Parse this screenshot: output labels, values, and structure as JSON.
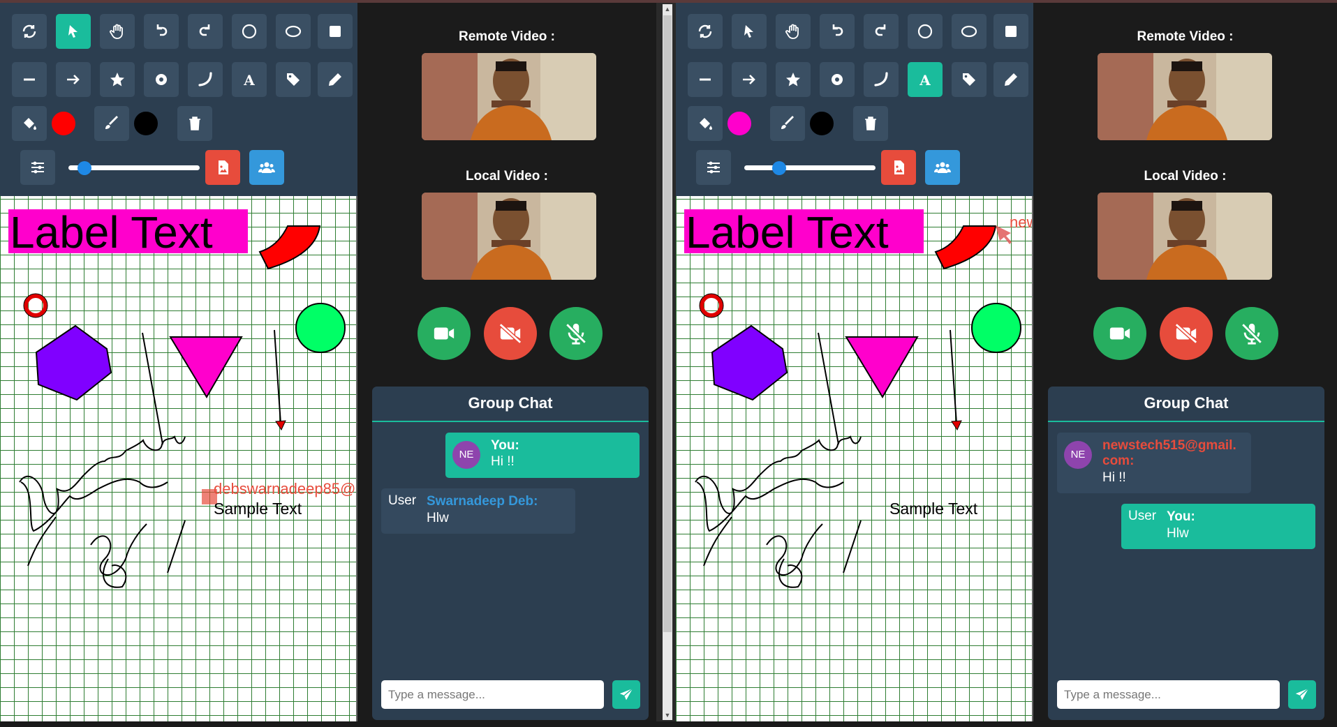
{
  "colors": {
    "toolbar_bg": "#2c3e50",
    "accent": "#1abc9c",
    "danger": "#e74c3c",
    "group": "#3498db",
    "chat_bg": "#2c3e50"
  },
  "toolbar_icons": [
    [
      "refresh-icon",
      "pointer-icon",
      "hand-icon",
      "undo-icon",
      "redo-icon",
      "circle-outline-icon",
      "ellipse-outline-icon",
      "square-icon"
    ],
    [
      "line-icon",
      "arrow-icon",
      "star-icon",
      "ring-icon",
      "arc-icon",
      "text-icon",
      "tag-icon",
      "pencil-icon"
    ],
    [
      "fill-bucket-icon",
      "brush-icon",
      "trash-icon"
    ],
    [
      "settings-sliders-icon",
      "export-image-icon",
      "group-users-icon"
    ]
  ],
  "left": {
    "fill_color": "#ff0000",
    "stroke_color": "#000000",
    "brush_size": 0.08,
    "canvas": {
      "label_text": "Label Text",
      "sample_text": "Sample Text",
      "cursor_user": "debswarnadeep85@"
    },
    "remote_label": "Remote Video :",
    "local_label": "Local Video :",
    "chat": {
      "title": "Group Chat",
      "messages": [
        {
          "avatar": "NE",
          "who": "You:",
          "text": "Hi !!"
        },
        {
          "avatar_alt": "User",
          "who": "Swarnadeep Deb:",
          "text": "Hlw"
        }
      ],
      "placeholder": "Type a message..."
    }
  },
  "right": {
    "fill_color": "#ff00cc",
    "stroke_color": "#000000",
    "brush_size": 0.24,
    "canvas": {
      "label_text": "Label Text",
      "sample_text": "Sample Text",
      "cursor_user": "new"
    },
    "remote_label": "Remote Video :",
    "local_label": "Local Video :",
    "chat": {
      "title": "Group Chat",
      "messages": [
        {
          "avatar": "NE",
          "who": "newstech515@gmail.\ncom:",
          "text": "Hi !!"
        },
        {
          "avatar_alt": "User",
          "who": "You:",
          "text": "Hlw"
        }
      ],
      "placeholder": "Type a message..."
    }
  }
}
